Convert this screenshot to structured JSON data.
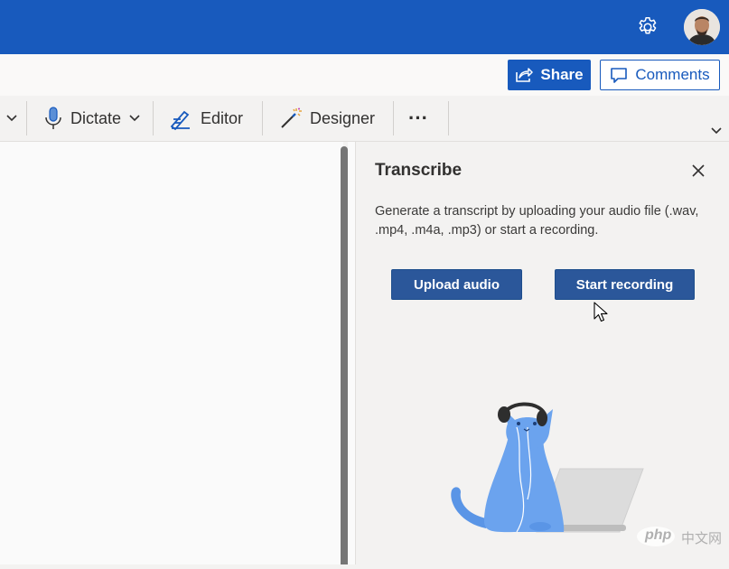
{
  "header": {
    "settings_icon": "gear-icon",
    "avatar_icon": "user-avatar",
    "brand_color": "#185abd"
  },
  "share_bar": {
    "share_label": "Share",
    "comments_label": "Comments"
  },
  "ribbon": {
    "dictate_label": "Dictate",
    "editor_label": "Editor",
    "designer_label": "Designer",
    "more_label": "···"
  },
  "transcribe_pane": {
    "title": "Transcribe",
    "description": "Generate a transcript by uploading your audio file (.wav, .mp4, .m4a, .mp3) or start a recording.",
    "upload_label": "Upload audio",
    "record_label": "Start recording",
    "button_color": "#2b579a"
  },
  "watermark": {
    "text_php": "php",
    "text_cn": "中文网"
  }
}
